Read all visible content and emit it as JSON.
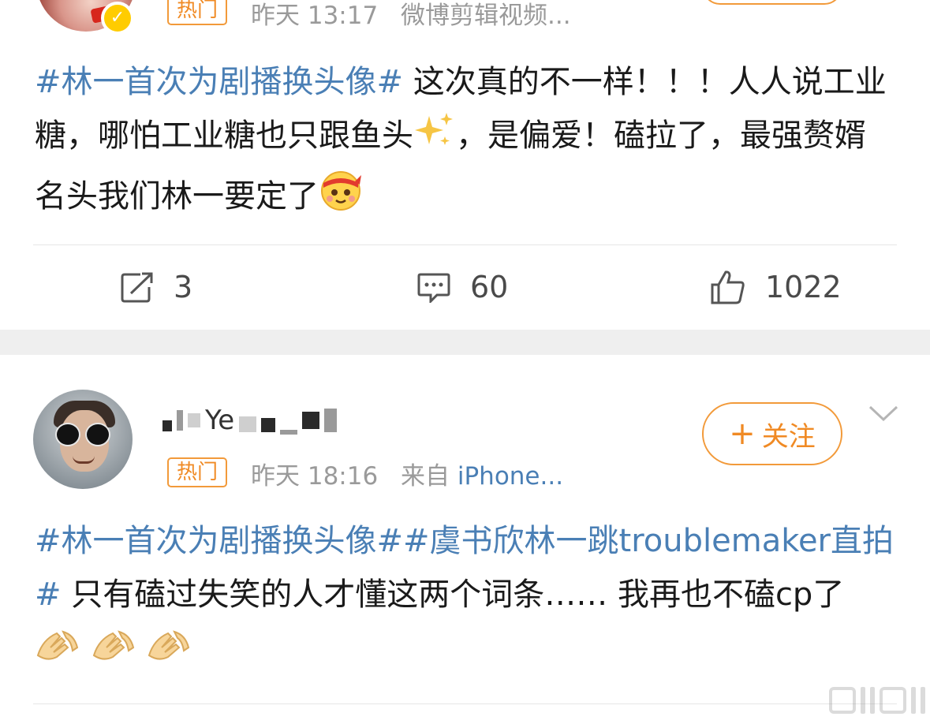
{
  "post1": {
    "hot_label": "热门",
    "time": "昨天 13:17",
    "source": "微博剪辑视频...",
    "topic": "#林一首次为剧播换头像#",
    "text_after_topic": " 这次真的不一样！！！人人说工业糖，哪怕工业糖也只跟鱼头",
    "text_after_sparkle": "，是偏爱！磕拉了，最强赘婿名头我们林一要定了",
    "actions": {
      "repost_count": "3",
      "comment_count": "60",
      "like_count": "1022"
    }
  },
  "post2": {
    "username_fragment": "Ye",
    "hot_label": "热门",
    "time": "昨天 18:16",
    "source_prefix": "来自 ",
    "source_device": "iPhone...",
    "follow_label": "关注",
    "follow_plus": "+",
    "topic1": "#林一首次为剧播换头像#",
    "topic2": "#虞书欣林一跳troublemaker直拍#",
    "text_after_topics": " 只有磕过失笑的人才懂这两个词条…… 我再也不磕cp了"
  },
  "colors": {
    "topic_link": "#4a7fb5",
    "hot_badge": "#f08a24",
    "verified_badge": "#ffcc00",
    "separator": "#efefef",
    "meta_text": "#9a9a9a"
  },
  "icons": {
    "repost": "repost-icon",
    "comment": "comment-icon",
    "like": "like-icon",
    "more": "chevron-down-icon",
    "sparkle": "sparkles-emoji",
    "headband": "headband-face-emoji",
    "pray": "pray-hands-emoji"
  }
}
